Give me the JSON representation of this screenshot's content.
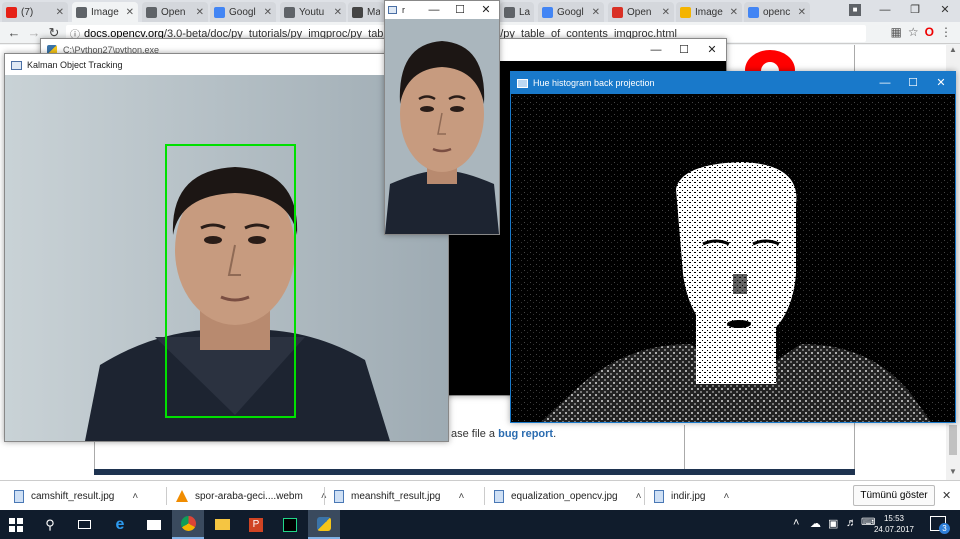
{
  "browser": {
    "tabs": [
      {
        "title": "(7)",
        "color": "#e62117"
      },
      {
        "title": "Image",
        "color": "#5f6368",
        "active": true
      },
      {
        "title": "Open",
        "color": "#5f6368"
      },
      {
        "title": "Googl",
        "color": "#4285f4"
      },
      {
        "title": "Youtu",
        "color": "#5f6368"
      },
      {
        "title": "Main",
        "color": "#444"
      },
      {
        "title": "",
        "color": "#999"
      },
      {
        "title": "La",
        "color": "#5f6368"
      },
      {
        "title": "Googl",
        "color": "#4285f4"
      },
      {
        "title": "Open",
        "color": "#d93025"
      },
      {
        "title": "Image",
        "color": "#f4b400"
      },
      {
        "title": "openc",
        "color": "#4285f4"
      }
    ],
    "url": "docs.opencv.org/3.0-beta/doc/py_tutorials/py_imgproc/py_table_of_contents_imgproc/py_table_of_contents_imgproc.html",
    "url_host": "docs.opencv.org",
    "url_path": "/3.0-beta/doc/py_tutorials/py_imgproc/py_table_of_contents_imgproc/py_table_of_contents_imgproc.html"
  },
  "page": {
    "bug_text": "ase file a ",
    "bug_link": "bug report",
    "bug_tail": "."
  },
  "windows": {
    "console_title": "C:\\Python27\\python.exe",
    "kalman_title": "Kalman Object Tracking",
    "roi_title": "r",
    "hue_title": "Hue histogram back projection"
  },
  "downloads": [
    {
      "name": "camshift_result.jpg",
      "kind": "image"
    },
    {
      "name": "spor-araba-geci....webm",
      "kind": "vlc"
    },
    {
      "name": "meanshift_result.jpg",
      "kind": "image"
    },
    {
      "name": "equalization_opencv.jpg",
      "kind": "image"
    },
    {
      "name": "indir.jpg",
      "kind": "image"
    }
  ],
  "download_show_all": "Tümünü göster",
  "taskbar": {
    "time": "15:53",
    "date": "24.07.2017",
    "notifications": "3"
  }
}
